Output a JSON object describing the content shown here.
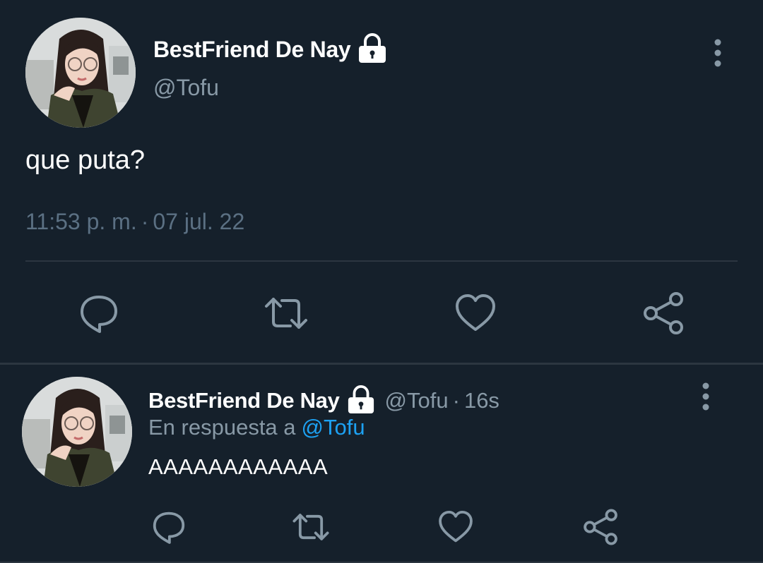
{
  "main_tweet": {
    "display_name": "BestFriend De Nay",
    "handle": "@Tofu",
    "text": "que puta?",
    "time": "11:53 p. m.",
    "separator": "·",
    "date": "07 jul. 22",
    "lock_icon": "lock-icon",
    "actions": [
      "reply-icon",
      "retweet-icon",
      "like-icon",
      "share-icon"
    ]
  },
  "reply_tweet": {
    "display_name": "BestFriend De Nay",
    "handle": "@Tofu",
    "separator": "·",
    "time_ago": "16s",
    "reply_prefix": "En respuesta a",
    "reply_mention": "@Tofu",
    "text": "AAAAAAAAAAAA",
    "actions": [
      "reply-icon",
      "retweet-icon",
      "like-icon",
      "share-icon"
    ]
  },
  "colors": {
    "background": "#15202b",
    "text": "#ffffff",
    "secondary_text": "#8899a6",
    "timestamp_text": "#5b7083",
    "icon": "#8899a6",
    "mention": "#1da1f2",
    "divider": "#2c3640"
  }
}
